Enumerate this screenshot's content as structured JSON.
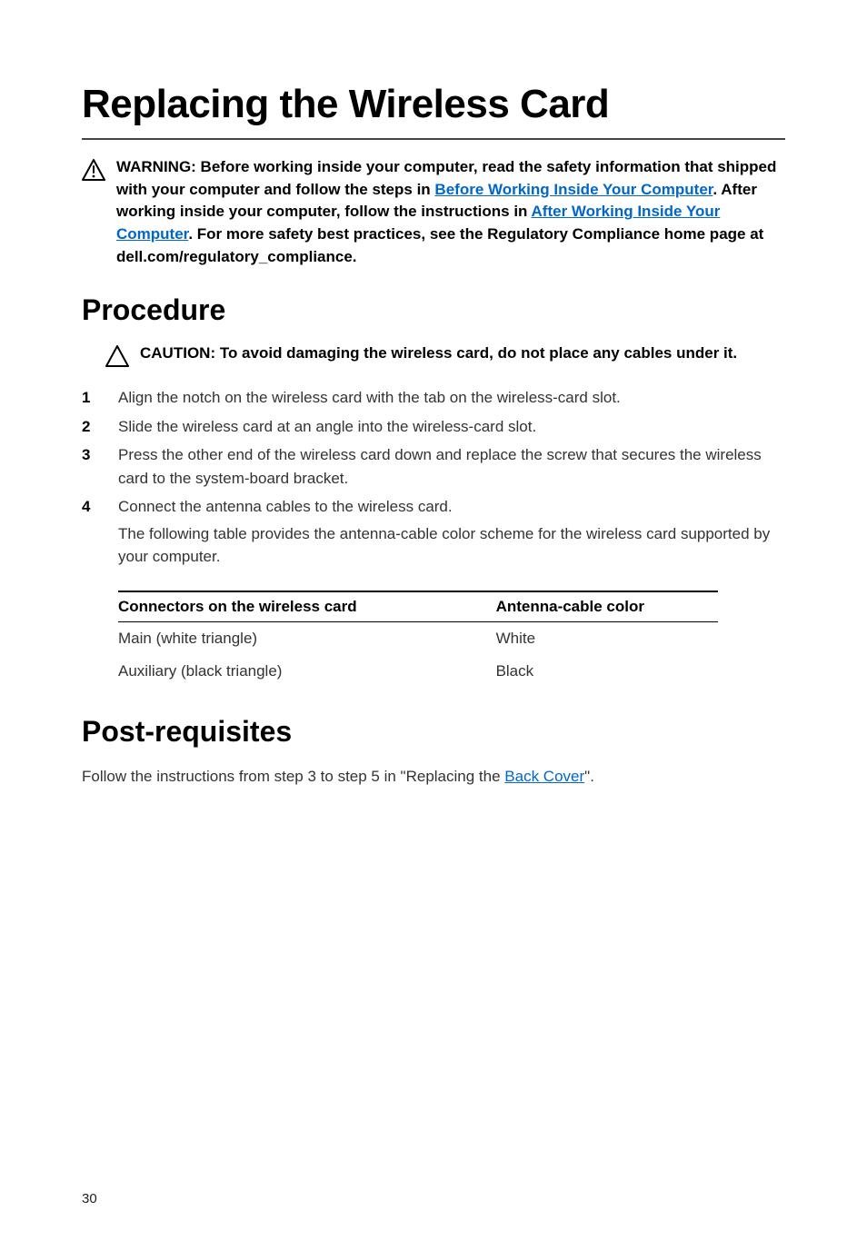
{
  "title": "Replacing the Wireless Card",
  "warning": {
    "prefix": "WARNING: Before working inside your computer, read the safety information that shipped with your computer and follow the steps in ",
    "link1": "Before Working Inside Your Computer",
    "mid1": ". After working inside your computer, follow the instructions in ",
    "link2": "After Working Inside Your Computer",
    "suffix": ". For more safety best practices, see the Regulatory Compliance home page at dell.com/regulatory_compliance."
  },
  "procedure": {
    "heading": "Procedure",
    "caution": "CAUTION: To avoid damaging the wireless card, do not place any cables under it.",
    "steps": [
      "Align the notch on the wireless card with the tab on the wireless-card slot.",
      "Slide the wireless card at an angle into the wireless-card slot.",
      "Press the other end of the wireless card down and replace the screw that secures the wireless card to the system-board bracket.",
      "Connect the antenna cables to the wireless card."
    ],
    "step4_sub": "The following table provides the antenna-cable color scheme for the wireless card supported by your computer.",
    "table": {
      "headers": [
        "Connectors on the wireless card",
        "Antenna-cable color"
      ],
      "rows": [
        [
          "Main (white triangle)",
          "White"
        ],
        [
          "Auxiliary (black triangle)",
          "Black"
        ]
      ]
    }
  },
  "postreq": {
    "heading": "Post-requisites",
    "text_prefix": "Follow the instructions from step 3 to step 5 in \"Replacing the ",
    "link": "Back Cover",
    "text_suffix": "\"."
  },
  "page_number": "30"
}
